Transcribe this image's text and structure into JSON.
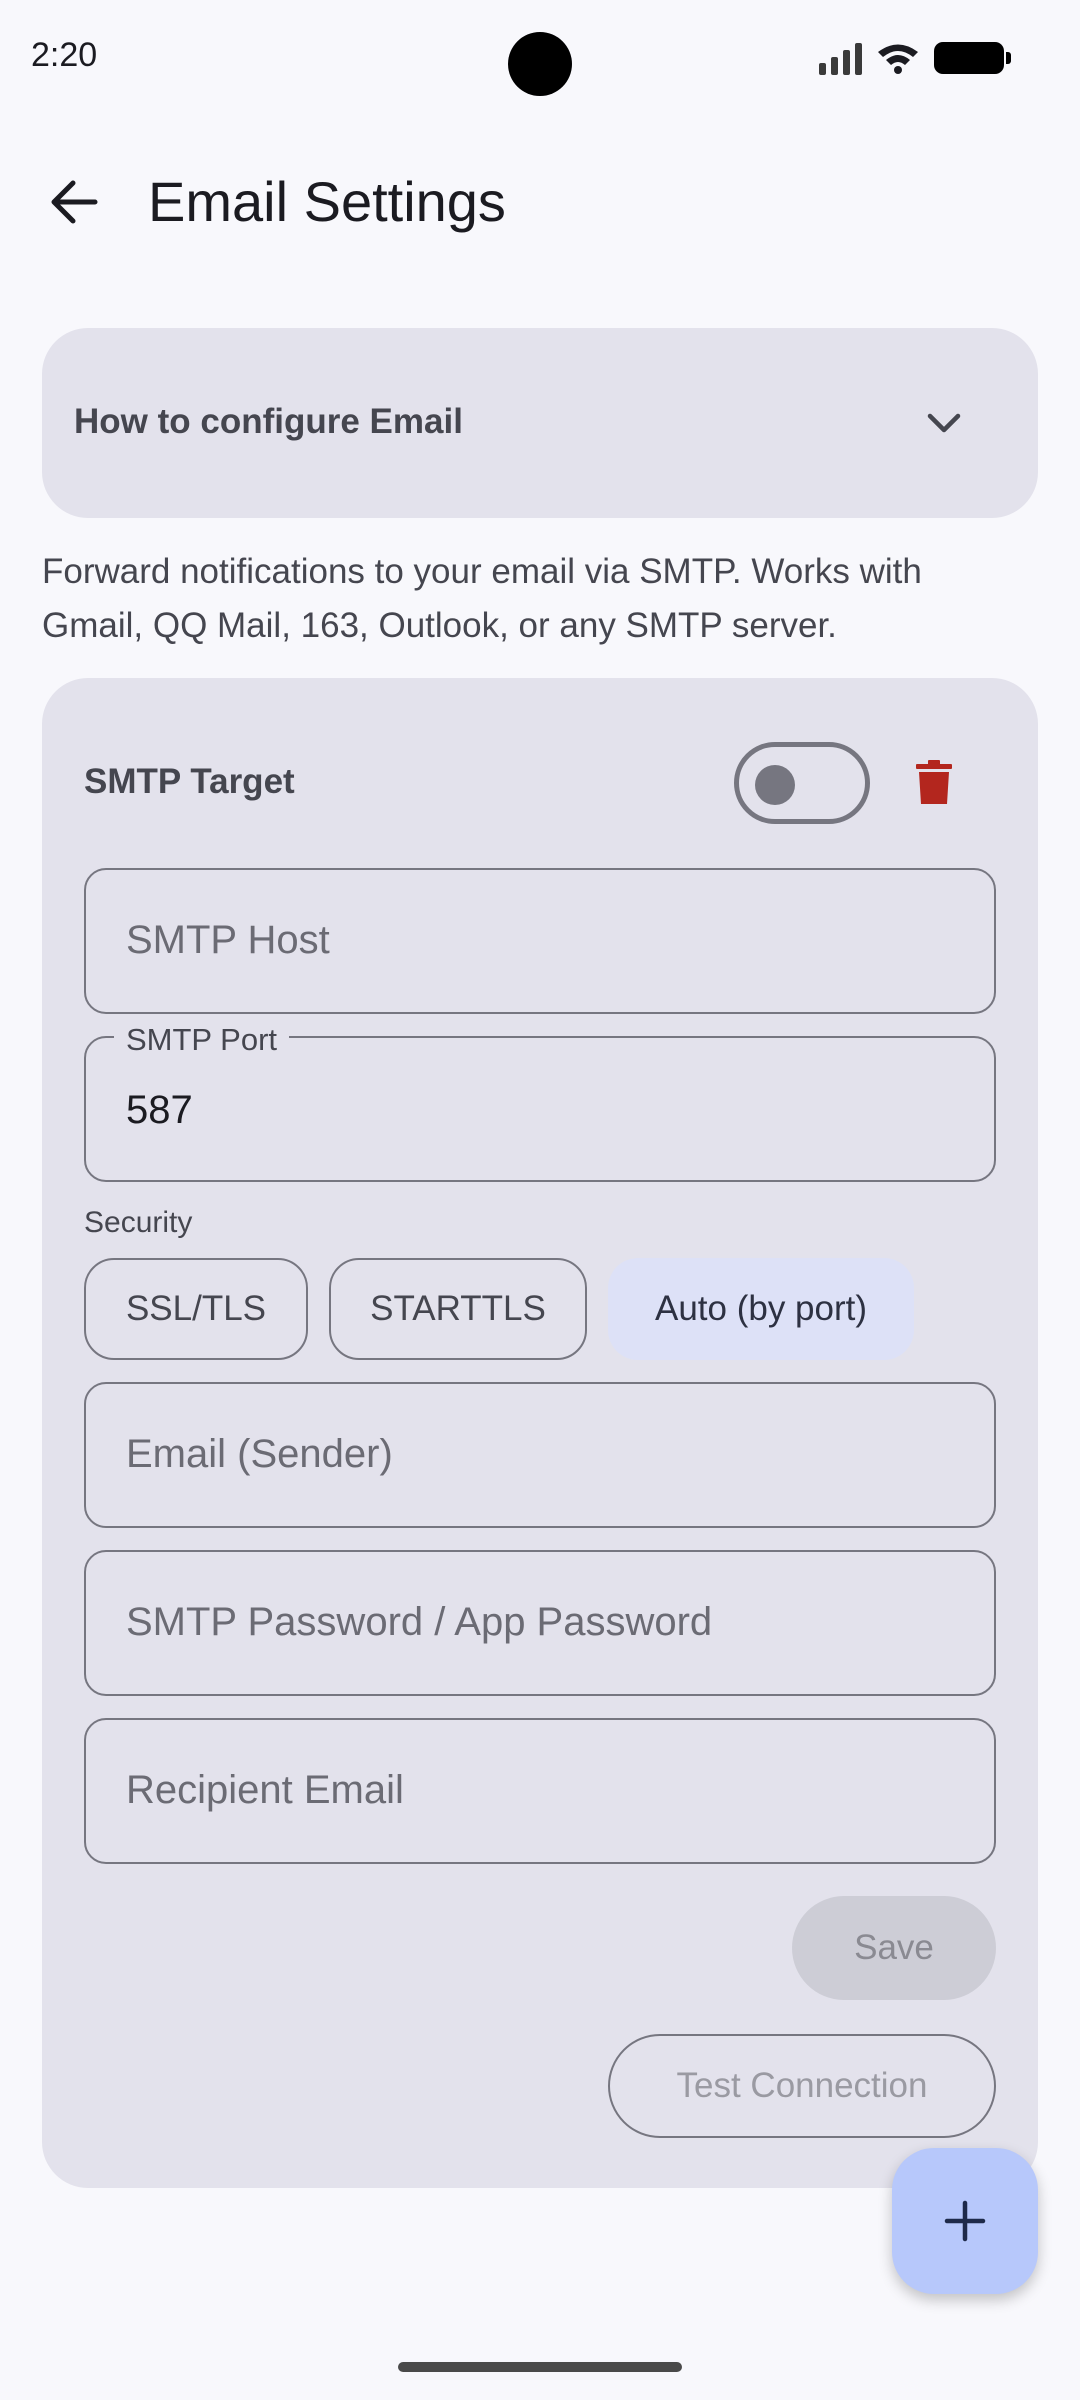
{
  "status_bar": {
    "time": "2:20"
  },
  "app_bar": {
    "title": "Email Settings",
    "back_icon": "arrow-back-icon"
  },
  "help": {
    "title": "How to configure Email",
    "icon": "chevron-down-icon"
  },
  "intro": "Forward notifications to your email via SMTP. Works with Gmail, QQ Mail, 163, Outlook, or any SMTP server.",
  "target": {
    "label": "SMTP Target",
    "enabled": false,
    "delete_icon": "trash-icon",
    "fields": {
      "host": {
        "placeholder": "SMTP Host",
        "value": ""
      },
      "port": {
        "label": "SMTP Port",
        "value": "587"
      },
      "sender": {
        "placeholder": "Email (Sender)",
        "value": ""
      },
      "password": {
        "placeholder": "SMTP Password / App Password",
        "value": ""
      },
      "recipient": {
        "placeholder": "Recipient Email",
        "value": ""
      }
    },
    "security": {
      "label": "Security",
      "options": [
        "SSL/TLS",
        "STARTTLS",
        "Auto (by port)"
      ],
      "selected": "Auto (by port)"
    },
    "save_label": "Save",
    "test_label": "Test Connection"
  },
  "fab_icon": "plus-icon",
  "colors": {
    "delete": "#b3261e",
    "fab": "#b7c8fb",
    "card": "#e3e2ec",
    "chip_selected": "#dde1f7"
  }
}
